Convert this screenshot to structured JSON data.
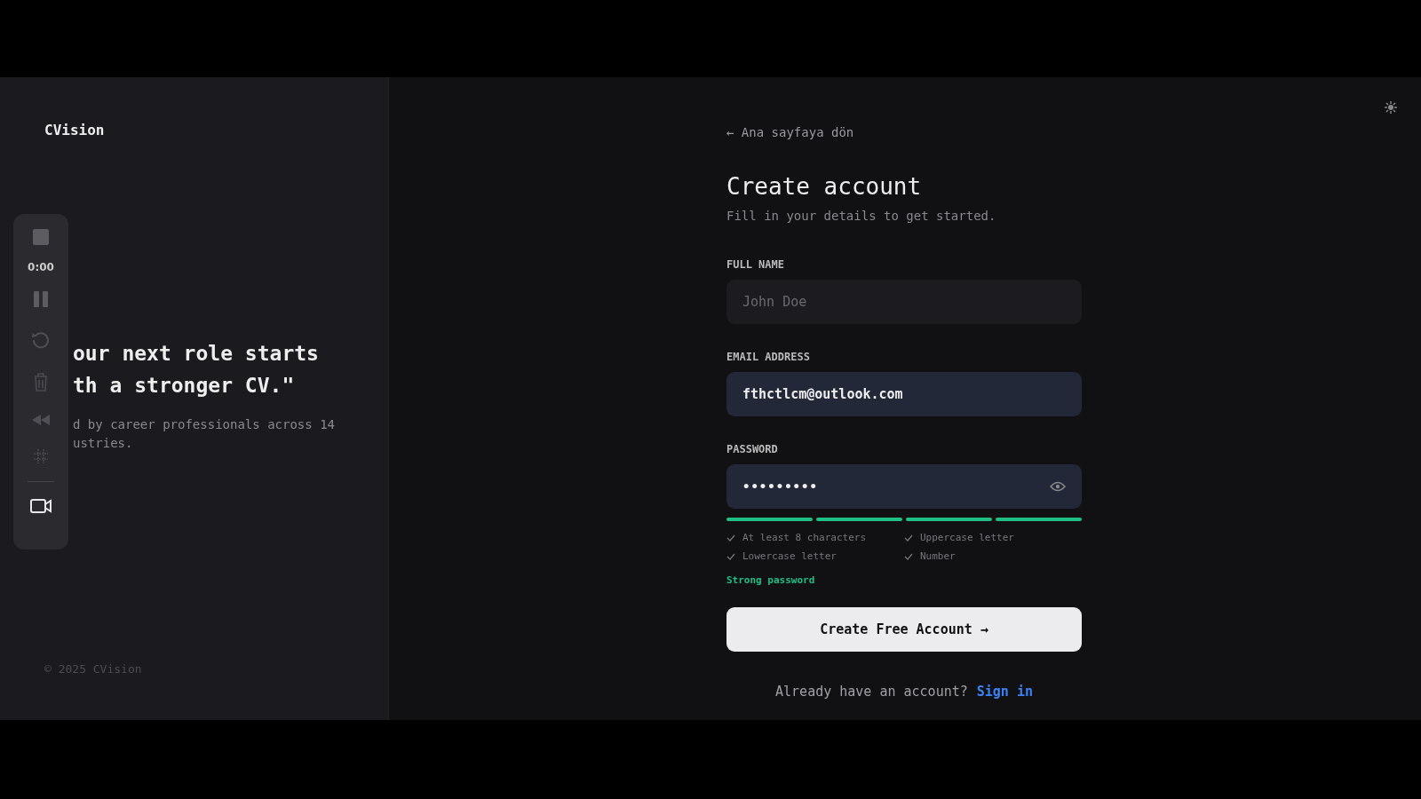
{
  "brand": "CVision",
  "quote": {
    "lines": [
      "our next role starts",
      "th a stronger CV.\""
    ],
    "caption": [
      "d by career professionals across 14",
      "ustries."
    ]
  },
  "footer": "© 2025 CVision",
  "recorder": {
    "time": "0:00"
  },
  "back_link": "← Ana sayfaya dön",
  "title": "Create account",
  "subtitle": "Fill in your details to get started.",
  "fields": [
    {
      "label": "FULL NAME",
      "placeholder": "John Doe",
      "kind": "text"
    },
    {
      "label": "EMAIL ADDRESS",
      "value": "fthctlcm@outlook.com",
      "kind": "text"
    },
    {
      "label": "PASSWORD",
      "value": "•••••••••",
      "kind": "password"
    }
  ],
  "strength": {
    "segments": [
      {
        "on": true
      },
      {
        "on": true
      },
      {
        "on": true
      },
      {
        "on": true
      }
    ],
    "rules": [
      {
        "text": "At least 8 characters",
        "checked": true
      },
      {
        "text": "Uppercase letter",
        "checked": true
      },
      {
        "text": "Lowercase letter",
        "checked": true
      },
      {
        "text": "Number",
        "checked": true
      }
    ],
    "label": "Strong password"
  },
  "submit": "Create Free Account →",
  "signin": {
    "prompt": "Already have an account?",
    "link": "Sign in"
  }
}
